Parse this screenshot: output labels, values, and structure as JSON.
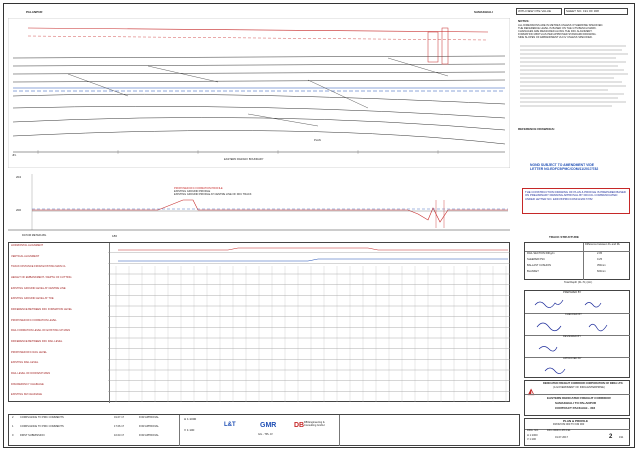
{
  "header": {
    "left_station": "PALANPUR",
    "right_station": "SAMAKHIALI",
    "revision_box": "WITH NEW OTE VALUE",
    "sheet_box": "SHEET NO. 191 OF 308"
  },
  "plan": {
    "label_jn": "JN.",
    "boundary_label": "EASTERN RAILWAY BOUNDARY",
    "km_label": "KM",
    "plan_tag": "PLAN"
  },
  "profile": {
    "legend": [
      "PROPOSED DFC FORMATION PROFILE",
      "EXISTING GROUND PROFILE",
      "EXISTING GROUND PROFILE AT CENTRE LINE OF DFC TRACK"
    ],
    "elevation_top": "204",
    "elevation_mid": "200",
    "elevation_low": "186",
    "datum_label": "DATUM METER ABL"
  },
  "data_rows": [
    "HORIZONTAL ALIGNMENT",
    "VERTICAL ALIGNMENT",
    "TRACK DISTANCE FROM EXISTING MAIN CL",
    "HEIGHT OF EMBANKMENT / DEPTH OF CUTTING",
    "EXISTING GROUND LEVEL AT CENTRE LINE",
    "EXISTING GROUND LEVEL AT TOE",
    "DIFFERENCE BETWEEN DFC FORMATION LEVEL",
    "PROPOSED DFC FORMATION LEVEL",
    "RAIL FORMATION LEVEL OF EXISTING UP MAIN",
    "DIFFERENCE BETWEEN DFC RAIL LEVEL",
    "PROPOSED DFC RAIL LEVEL",
    "EXISTING RAIL LEVEL",
    "RAIL LEVEL OF DOWN/UP MAIN",
    "DISCREPANCY CHAINAGE",
    "EXISTING KM CHAINAGE"
  ],
  "notes": {
    "title": "NOTES:",
    "lines": [
      "ALL DIMENSIONS ARE IN METRES UNLESS OTHERWISE SPECIFIED.",
      "THE REFERENCE LEVEL IS BASED ON THE GTS BENCH MARK.",
      "CHAINAGES ARE MEASURED ALONG THE DFC ALIGNMENT.",
      "FORMATION WIDTH AS PER APPROVED STANDARD DRAWING.",
      "SIDE SLOPES OF EMBANKMENT 2H:1V UNLESS SPECIFIED."
    ],
    "reference_title": "REFERENCE DRAWINGS:"
  },
  "approval_stamp": {
    "line1": "NOND SUBJECT TO AMENDMENT VIDE",
    "line2": "LETTER NO.EDFC5/PMC/COM/11/2017/782"
  },
  "revision_note": "THE CONSTRUCTION DRAWING OF PLAN & PROFILE IS PREPARED BASED ON PRELIMINARY DRAWING APPROVAL BY DFCCIL COMMUNICATED UNDER LETTER NO. EDFC5/PMC/COM/11/2017/782",
  "track_structure": {
    "title": "TRACK STRUCTURE",
    "headers": [
      "",
      "Difference between FL and RL"
    ],
    "rows": [
      [
        "RAIL SECTION 60Kg/m",
        "2.05"
      ],
      [
        "SLEEPER PSC",
        "0.25"
      ],
      [
        "BALLAST CUSHION",
        "350mm"
      ],
      [
        "BLANKET",
        "600mm"
      ]
    ],
    "total": "Total Depth (FL-TL) (Ht.)"
  },
  "signatures": {
    "prepared_by": "PREPARED BY",
    "checked_by": "CHECKED BY",
    "approved_by": "APPROVED BY",
    "reviewed_by": "REVIEWED BY"
  },
  "client": {
    "name": "DEDICATED FREIGHT CORRIDOR CORPORATION OF INDIA LTD.",
    "sub": "(A GOVERNMENT OF INDIA ENTERPRISE)",
    "project": "EASTERN DEDICATED FREIGHT CORRIDOR",
    "package": "SAMAKHIALI TO PALANPUR",
    "contract": "CONTRACT PACKAGE - 302"
  },
  "title_block": {
    "drawing_title": "PLAN & PROFILE",
    "location": "FROM KM 000 TO KM 000",
    "drawing_no_label": "DRG. NO.",
    "drawing_no": "DFC-WDFC-PP-191",
    "scale_label": "SCALE",
    "scale_h": "H 1:1000",
    "scale_v": "V 1:100",
    "date_label": "DATE",
    "date": "01.07.2017",
    "rev_label": "REV.",
    "rev": "2",
    "sheet_label": "SHEET NO.",
    "sheet": "191"
  },
  "revisions": [
    {
      "no": "2",
      "desc": "COMPLIANCE TO PMC COMMENTS",
      "date": "01.07.17",
      "status": "FOR APPROVAL"
    },
    {
      "no": "1",
      "desc": "COMPLIANCE TO PMC COMMENTS",
      "date": "17.06.17",
      "status": "FOR APPROVAL"
    },
    {
      "no": "0",
      "desc": "FIRST SUBMISSION",
      "date": "10.03.17",
      "status": "FOR APPROVAL"
    }
  ],
  "logos": {
    "contractor": "GIL - TPL JV",
    "designer": "DB Engineering & Consulting GmbH",
    "consultant": "GMR",
    "jv": "L&T"
  },
  "colors": {
    "red": "#c62828",
    "blue": "#1f4fb5",
    "line": "#444444"
  }
}
